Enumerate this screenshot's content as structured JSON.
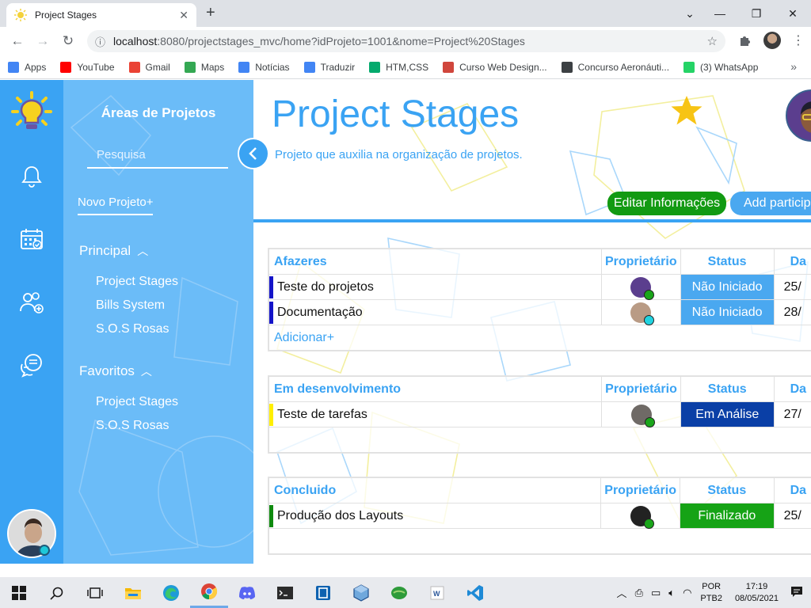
{
  "browser": {
    "tab_title": "Project Stages",
    "url_host": "localhost",
    "url_path": ":8080/projectstages_mvc/home?idProjeto=1001&nome=Project%20Stages",
    "bookmarks": [
      {
        "label": "Apps",
        "icon": "apps-grid-icon",
        "color": "#4285f4"
      },
      {
        "label": "YouTube",
        "icon": "youtube-icon",
        "color": "#ff0000"
      },
      {
        "label": "Gmail",
        "icon": "gmail-icon",
        "color": "#ea4335"
      },
      {
        "label": "Maps",
        "icon": "maps-icon",
        "color": "#34a853"
      },
      {
        "label": "Notícias",
        "icon": "news-icon",
        "color": "#4285f4"
      },
      {
        "label": "Traduzir",
        "icon": "translate-icon",
        "color": "#4285f4"
      },
      {
        "label": "HTM,CSS",
        "icon": "w3schools-icon",
        "color": "#04aa6d"
      },
      {
        "label": "Curso Web Design...",
        "icon": "udemy-icon",
        "color": "#d0463c"
      },
      {
        "label": "Concurso Aeronáuti...",
        "icon": "concurso-icon",
        "color": "#3c4043"
      },
      {
        "label": "(3) WhatsApp",
        "icon": "whatsapp-icon",
        "color": "#25d366"
      }
    ]
  },
  "sidebar": {
    "title": "Áreas de Projetos",
    "search_placeholder": "Pesquisa",
    "new_project": "Novo Projeto+",
    "sections": [
      {
        "label": "Principal",
        "items": [
          "Project Stages",
          "Bills System",
          "S.O.S Rosas"
        ]
      },
      {
        "label": "Favoritos",
        "items": [
          "Project Stages",
          "S.O.S Rosas"
        ]
      }
    ]
  },
  "project": {
    "title": "Project Stages",
    "subtitle": "Projeto que auxilia na organização de projetos.",
    "edit_button": "Editar Informações",
    "add_button": "Add particip"
  },
  "columns": {
    "owner": "Proprietário",
    "status": "Status",
    "date": "Da"
  },
  "stages": [
    {
      "name": "Afazeres",
      "add_label": "Adicionar+",
      "tasks": [
        {
          "name": "Teste do projetos",
          "bar": "#1414c8",
          "status": "Não Iniciado",
          "status_color": "#4aa8f0",
          "date": "25/",
          "owner_color": "#5b3e8e",
          "dot": "#1aa51a"
        },
        {
          "name": "Documentação",
          "bar": "#1414c8",
          "status": "Não Iniciado",
          "status_color": "#4aa8f0",
          "date": "28/",
          "owner_color": "#b99b85",
          "dot": "#21d3e0"
        }
      ]
    },
    {
      "name": "Em desenvolvimento",
      "tasks": [
        {
          "name": "Teste de tarefas",
          "bar": "#ffef00",
          "status": "Em Análise",
          "status_color": "#0a3fa6",
          "date": "27/",
          "owner_color": "#6f6a66",
          "dot": "#1aa51a"
        }
      ]
    },
    {
      "name": "Concluido",
      "tasks": [
        {
          "name": "Produção dos Layouts",
          "bar": "#0f8a0f",
          "status": "Finalizado",
          "status_color": "#16a316",
          "date": "25/",
          "owner_color": "#222222",
          "dot": "#1aa51a"
        }
      ]
    }
  ],
  "taskbar": {
    "lang_1": "POR",
    "lang_2": "PTB2",
    "time": "17:19",
    "date": "08/05/2021"
  },
  "colors": {
    "primary": "#3aa3f3",
    "sidebar": "#6bbcf8",
    "edit_button": "#129a12"
  }
}
